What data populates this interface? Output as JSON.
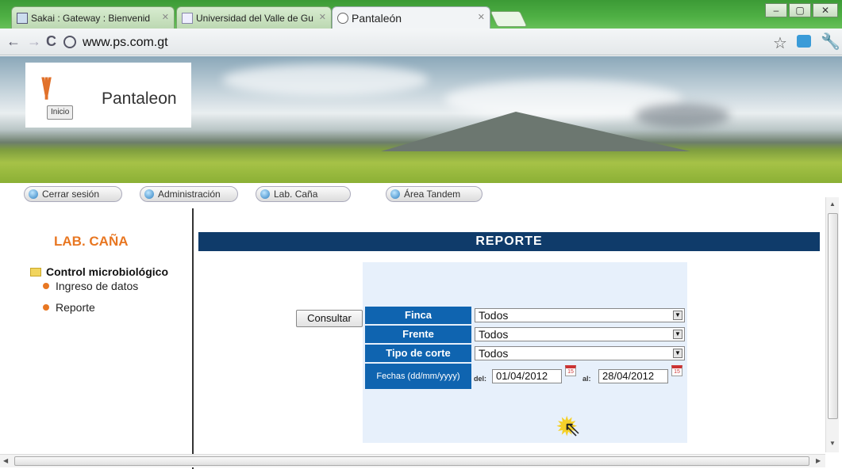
{
  "browser": {
    "tabs": [
      {
        "label": "Sakai : Gateway : Bienvenid"
      },
      {
        "label": "Universidad del Valle de Gu"
      },
      {
        "label": "Pantaleón"
      }
    ],
    "url": "www.ps.com.gt",
    "window_controls": {
      "minimize": "–",
      "maximize": "▢",
      "close": "✕"
    }
  },
  "site": {
    "logo_text": "Pantaleon",
    "inicio_label": "Inicio"
  },
  "nav": {
    "items": [
      {
        "label": "Cerrar sesión"
      },
      {
        "label": "Administración"
      },
      {
        "label": "Lab. Caña"
      },
      {
        "label": "Área Tandem"
      }
    ]
  },
  "sidebar": {
    "title": "LAB. CAÑA",
    "section": "Control microbiológico",
    "items": [
      {
        "label": "Ingreso de datos"
      },
      {
        "label": "Reporte"
      }
    ]
  },
  "report": {
    "title": "REPORTE",
    "fields": {
      "finca": {
        "label": "Finca",
        "value": "Todos"
      },
      "frente": {
        "label": "Frente",
        "value": "Todos"
      },
      "tipo_corte": {
        "label": "Tipo de corte",
        "value": "Todos"
      }
    },
    "dates": {
      "label": "Fechas (dd/mm/yyyy)",
      "del_label": "del:",
      "del_value": "01/04/2012",
      "al_label": "al:",
      "al_value": "28/04/2012",
      "calendar_day": "15"
    },
    "submit_label": "Consultar"
  },
  "colors": {
    "header_blue": "#0f3b6a",
    "label_blue": "#0f64b0",
    "accent_orange": "#e87722",
    "form_bg": "#e7f0fb"
  },
  "icons": [
    "globe-icon",
    "star-icon",
    "wrench-icon",
    "folder-icon",
    "bullet-icon",
    "calendar-icon",
    "mouse-cursor-icon"
  ]
}
